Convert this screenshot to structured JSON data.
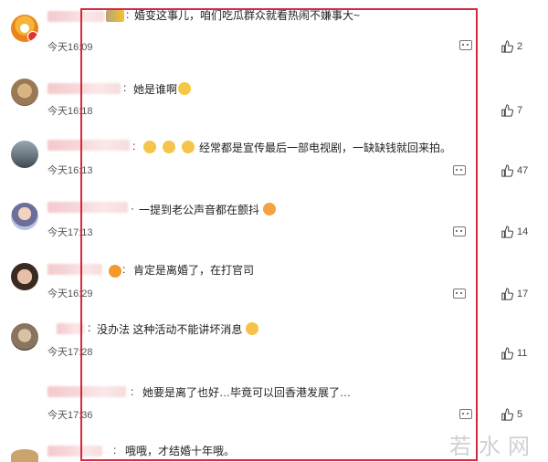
{
  "comments": [
    {
      "text": "婚变这事儿，咱们吃瓜群众就看热闹不嫌事大~",
      "time": "今天16:09",
      "likes": "2",
      "emojis": []
    },
    {
      "text": "她是谁啊",
      "time": "今天16:18",
      "likes": "7",
      "emojis": [
        "grin"
      ]
    },
    {
      "text": "经常都是宣传最后一部电视剧，一缺缺钱就回来拍。",
      "time": "今天16:13",
      "likes": "47",
      "emojis": [
        "cat",
        "cat",
        "cat"
      ]
    },
    {
      "text": "一提到老公声音都在颤抖",
      "time": "今天17:13",
      "likes": "14",
      "emojis": [
        "kiss"
      ]
    },
    {
      "text": "肯定是离婚了，在打官司",
      "time": "今天16:29",
      "likes": "17",
      "emojis": [
        "fire"
      ]
    },
    {
      "text": "没办法 这种活动不能讲坏消息",
      "time": "今天17:28",
      "likes": "11",
      "emojis": [
        "smirk"
      ]
    },
    {
      "text": "她要是离了也好…毕竟可以回香港发展了…",
      "time": "今天17:36",
      "likes": "5",
      "emojis": []
    },
    {
      "text": "哦哦，才结婚十年哦。",
      "time": "",
      "likes": "",
      "emojis": []
    }
  ],
  "watermark": "若水网",
  "colors": {
    "frame": "#d6283d",
    "text": "#222222",
    "meta": "#555555"
  }
}
